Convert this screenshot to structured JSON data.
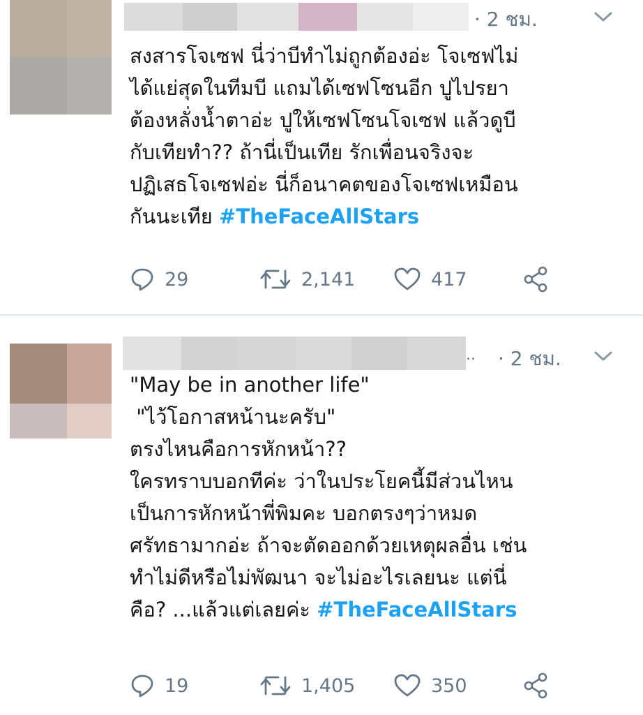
{
  "tweets": [
    {
      "time": "· 2 ชม.",
      "name_ellipsis": "",
      "lines": [
        "สงสารโจเซฟ นี่ว่าบีทำไม่ถูกต้องอ่ะ โจเซฟไม่",
        "ได้แย่สุดในทีมบี แถมได้เซฟโซนอีก ปูไปรยา",
        "ต้องหลั่งน้ำตาอ่ะ ปูให้เซฟโซนโจเซฟ แล้วดูบี",
        "กับเทียทำ?? ถ้านี่เป็นเทีย รักเพื่อนจริงจะ",
        "ปฏิเสธโจเซฟอ่ะ นี่ก็อนาคตของโจเซฟเหมือน"
      ],
      "last_line_text": "กันนะเทีย ",
      "hashtag": "#TheFaceAllStars",
      "replies": "29",
      "retweets": "2,141",
      "likes": "417",
      "icons": {
        "reply": "reply-icon",
        "retweet": "retweet-icon",
        "like": "heart-icon",
        "share": "share-icon",
        "menu": "chevron-down-icon"
      }
    },
    {
      "time": "· 2 ชม.",
      "name_ellipsis": "..",
      "lines": [
        "\"May be in another life\"",
        " \"ไว้โอกาสหน้านะครับ\"",
        "ตรงไหนคือการหักหน้า??",
        "ใครทราบบอกทีค่ะ ว่าในประโยคนี้มีส่วนไหน",
        "เป็นการหักหน้าพี่พิมคะ บอกตรงๆว่าหมด",
        "ศรัทธามากอ่ะ ถ้าจะตัดออกด้วยเหตุผลอื่น เช่น",
        "ทำไม่ดีหรือไม่พัฒนา จะไม่อะไรเลยนะ แต่นี่"
      ],
      "last_line_text": "คือ? ...แล้วแต่เลยค่ะ ",
      "hashtag": "#TheFaceAllStars",
      "replies": "19",
      "retweets": "1,405",
      "likes": "350",
      "icons": {
        "reply": "reply-icon",
        "retweet": "retweet-icon",
        "like": "heart-icon",
        "share": "share-icon",
        "menu": "chevron-down-icon"
      }
    }
  ],
  "colors": {
    "text": "#14171a",
    "muted": "#657786",
    "hashtag": "#1da1f2",
    "divider": "#e1e8ed"
  }
}
